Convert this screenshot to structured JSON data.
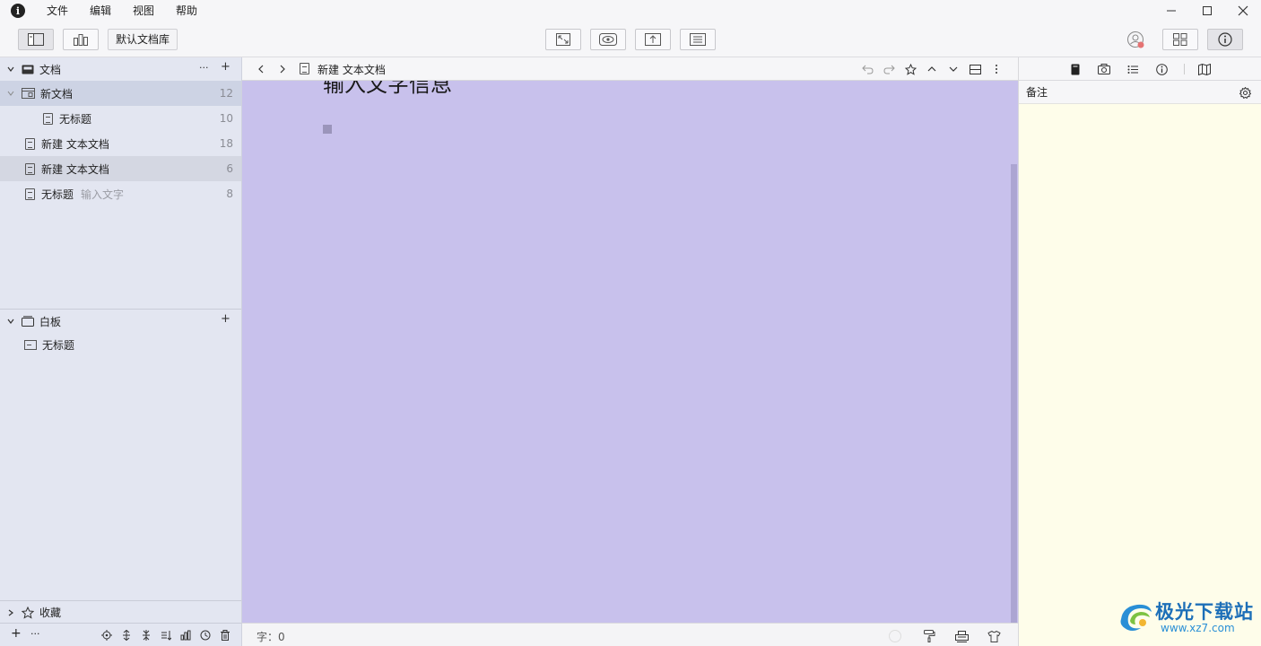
{
  "menubar": {
    "items": [
      "文件",
      "编辑",
      "视图",
      "帮助"
    ]
  },
  "toolbar": {
    "library_label": "默认文档库"
  },
  "sidebar": {
    "docs_section": {
      "title": "文档",
      "more": "···",
      "add": "+"
    },
    "items": [
      {
        "label": "新文档",
        "count": "12",
        "sub": ""
      },
      {
        "label": "无标题",
        "count": "10",
        "sub": ""
      },
      {
        "label": "新建 文本文档",
        "count": "18",
        "sub": ""
      },
      {
        "label": "新建 文本文档",
        "count": "6",
        "sub": ""
      },
      {
        "label": "无标题",
        "count": "8",
        "sub": "输入文字"
      }
    ],
    "whiteboard_section": {
      "title": "白板",
      "add": "+",
      "items": [
        {
          "label": "无标题"
        }
      ]
    },
    "favorites_section": {
      "title": "收藏"
    },
    "bottom": {
      "add": "+",
      "more": "···"
    }
  },
  "editor": {
    "breadcrumb_title": "新建 文本文档",
    "heading_text": "输入文字信息",
    "status": {
      "word_count": "字：0"
    },
    "background": "#c8c1ec"
  },
  "inspector": {
    "notes_label": "备注",
    "notes_background": "#fefdea"
  },
  "watermark": {
    "text": "极光下载站",
    "url": "www.xz7.com"
  }
}
